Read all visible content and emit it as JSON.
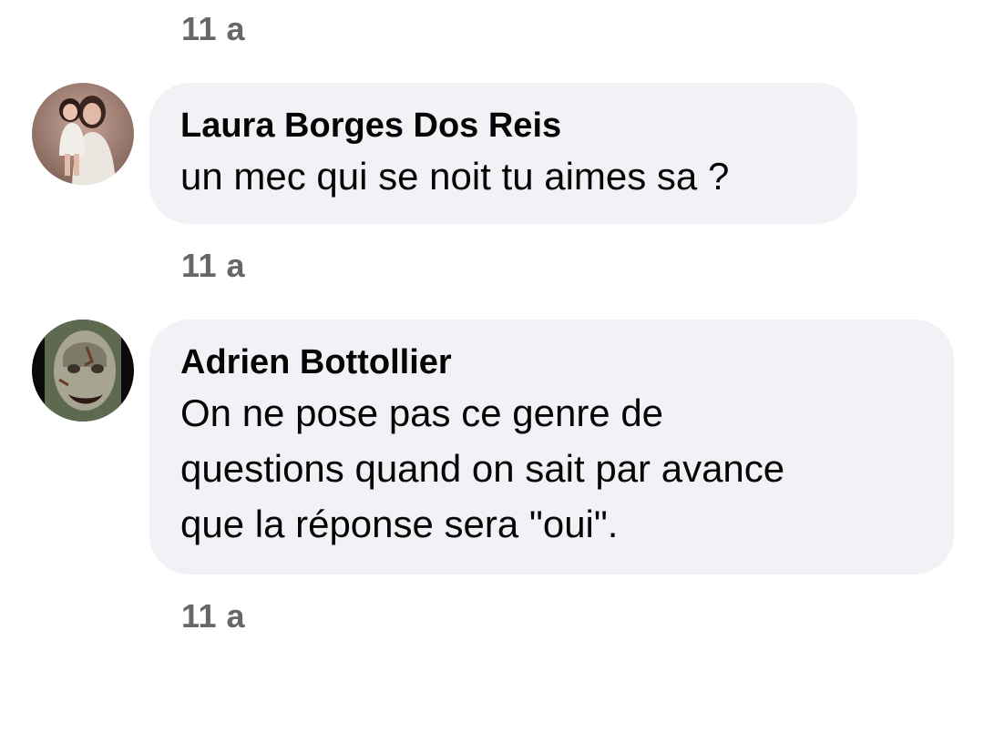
{
  "timestamps": {
    "top": "11 a",
    "after_first": "11 a",
    "after_second": "11 a"
  },
  "comments": [
    {
      "author": "Laura Borges Dos Reis",
      "text": "un mec qui se noit tu aimes sa ?"
    },
    {
      "author": "Adrien Bottollier",
      "text_lines": [
        "On ne pose pas ce genre de",
        "questions quand on sait par avance",
        "que la réponse sera \"oui\"."
      ]
    }
  ],
  "colors": {
    "bubble": "#f0f2f5",
    "timestamp": "#65676b",
    "text": "#050505"
  }
}
